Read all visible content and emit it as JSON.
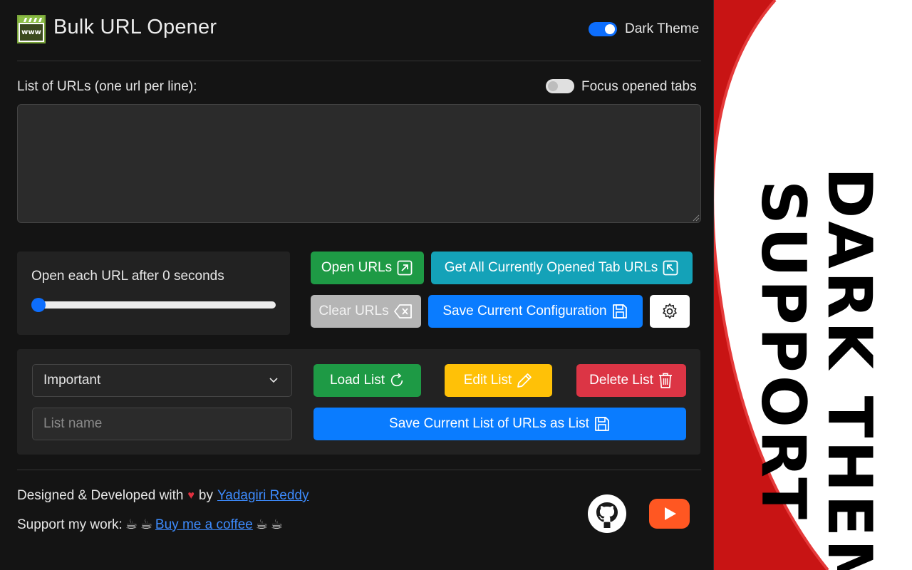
{
  "header": {
    "title": "Bulk URL Opener",
    "logo_text": "www",
    "dark_theme_label": "Dark Theme",
    "dark_theme_enabled": true
  },
  "urls": {
    "label": "List of URLs (one url per line):",
    "focus_label": "Focus opened tabs",
    "focus_enabled": false,
    "value": ""
  },
  "delay": {
    "label": "Open each URL after 0 seconds",
    "value_seconds": 0
  },
  "actions": {
    "open_urls": "Open URLs",
    "get_tabs": "Get All Currently Opened Tab URLs",
    "clear_urls": "Clear URLs",
    "save_config": "Save Current Configuration"
  },
  "lists": {
    "selected": "Important",
    "name_placeholder": "List name",
    "load": "Load List",
    "edit": "Edit List",
    "delete": "Delete List",
    "save_as_list": "Save Current List of URLs as List"
  },
  "footer": {
    "designed_prefix": "Designed & Developed with",
    "designed_by": "by",
    "author": "Yadagiri Reddy",
    "support_prefix": "Support my work:",
    "coffee_link": "Buy me a coffee"
  },
  "banner": {
    "line1": "DARK THEME",
    "line2": "SUPPORT"
  },
  "colors": {
    "primary": "#0d6efd",
    "success": "#1e9a45",
    "info": "#14a2b8",
    "warning": "#ffc107",
    "danger": "#dc3545",
    "banner_red": "#d81818"
  }
}
